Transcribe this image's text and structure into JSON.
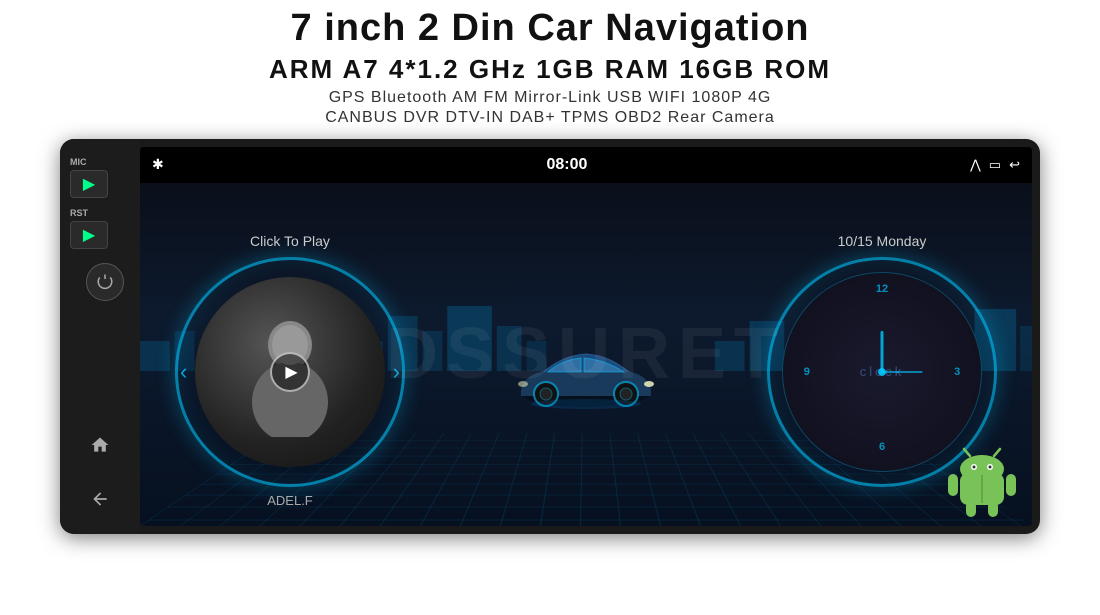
{
  "header": {
    "main_title": "7 inch 2 Din Car Navigation",
    "specs": "ARM A7 4*1.2 GHz    1GB RAM    16GB ROM",
    "features_line1": "GPS  Bluetooth  AM  FM  Mirror-Link  USB  WIFI  1080P  4G",
    "features_line2": "CANBUS   DVR   DTV-IN   DAB+   TPMS   OBD2   Rear Camera"
  },
  "screen": {
    "top_bar": {
      "bluetooth_icon": "bluetooth",
      "time": "08:00",
      "wifi_icon": "wifi",
      "back_icon": "back"
    },
    "music_panel": {
      "click_to_play": "Click To Play",
      "track_name": "ADEL.F",
      "prev_arrow": "‹",
      "next_arrow": "›"
    },
    "clock_panel": {
      "date": "10/15 Monday",
      "clock_label": "clock",
      "numbers": [
        "12",
        "3",
        "6",
        "9"
      ]
    },
    "watermark": "DSSURET"
  },
  "left_panel": {
    "mic_label": "MIC",
    "rst_label": "RST",
    "buttons": [
      {
        "label": "▶",
        "name": "play-button"
      },
      {
        "label": "⏻",
        "name": "power-button"
      }
    ],
    "nav_icons": [
      "🏠",
      "↩"
    ]
  }
}
